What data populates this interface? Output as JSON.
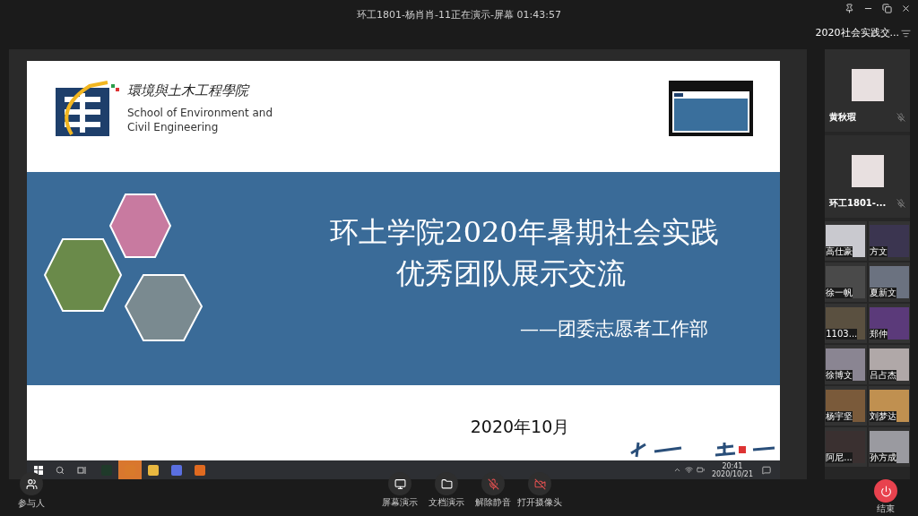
{
  "window": {
    "title": "环工1801-杨肖肖-11正在演示-屏幕 01:43:57"
  },
  "panel": {
    "title": "2020社会实践交..."
  },
  "slide": {
    "logo_script": "環境與土木工程學院",
    "school_en_1": "School of Environment and",
    "school_en_2": "Civil Engineering",
    "title_1": "环土学院2020年暑期社会实践",
    "title_2": "优秀团队展示交流",
    "subtitle": "——团委志愿者工作部",
    "date": "2020年10月"
  },
  "taskbar": {
    "apps": [
      {
        "kind": "green",
        "selected": false
      },
      {
        "kind": "orange",
        "selected": true
      },
      {
        "kind": "folder",
        "selected": false
      },
      {
        "kind": "browser",
        "selected": false
      },
      {
        "kind": "player",
        "selected": false
      }
    ],
    "time": "20:41",
    "date": "2020/10/21"
  },
  "speakers": [
    {
      "name": "黄秋瑕",
      "muted": true
    },
    {
      "name": "环工1801-...",
      "muted": true
    }
  ],
  "participants": [
    {
      "name": "高仕豪",
      "color": "#c9c9cf"
    },
    {
      "name": "方文",
      "color": "#3b3550"
    },
    {
      "name": "徐一帆",
      "color": "#4a4a4a"
    },
    {
      "name": "夏新文",
      "color": "#6b7280"
    },
    {
      "name": "1103...",
      "color": "#5a5040"
    },
    {
      "name": "郑仲",
      "color": "#5b3a7a"
    },
    {
      "name": "徐博文",
      "color": "#8a8592"
    },
    {
      "name": "吕占杰",
      "color": "#b0a8a8"
    },
    {
      "name": "杨宇坚",
      "color": "#7a5a3a"
    },
    {
      "name": "刘梦达",
      "color": "#c09050"
    },
    {
      "name": "阿尼...",
      "color": "#3a3030"
    },
    {
      "name": "孙方成",
      "color": "#9a9aa0"
    }
  ],
  "toolbar": {
    "participants": "参与人",
    "buttons": [
      {
        "kind": "screen",
        "label": "屏幕演示"
      },
      {
        "kind": "doc",
        "label": "文档演示"
      },
      {
        "kind": "mic",
        "label": "解除静音",
        "muted": true
      },
      {
        "kind": "camera",
        "label": "打开摄像头",
        "muted": true
      }
    ],
    "end": "结束"
  }
}
